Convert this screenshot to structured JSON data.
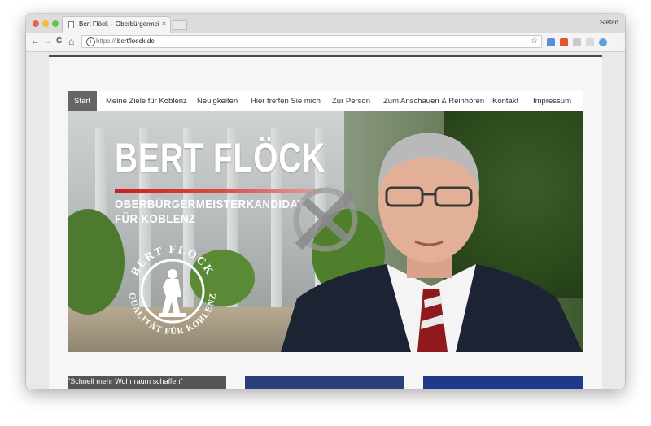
{
  "browser": {
    "tab_title": "Bert Flöck – Oberbürgermeiste",
    "tab_close": "×",
    "profile_name": "Stefan",
    "url_prefix": "https://",
    "url_host": "bertfloeck.de",
    "nav_icons": [
      "back-icon",
      "forward-icon",
      "reload-icon",
      "home-icon"
    ],
    "back_glyph": "←",
    "forward_glyph": "→",
    "reload_glyph": "C",
    "home_glyph": "⌂",
    "info_glyph": "i",
    "star_glyph": "☆",
    "menu_glyph": "⋮"
  },
  "site": {
    "nav": [
      {
        "label": "Start",
        "active": true
      },
      {
        "label": "Meine Ziele für Koblenz"
      },
      {
        "label": "Neuigkeiten"
      },
      {
        "label": "Hier treffen Sie mich"
      },
      {
        "label": "Zur Person"
      },
      {
        "label": "Zum Anschauen & Reinhören"
      },
      {
        "label": "Kontakt"
      },
      {
        "label": "Impressum"
      }
    ],
    "hero": {
      "title": "BERT FLÖCK",
      "subtitle_line1": "OBERBÜRGERMEISTERKANDIDAT",
      "subtitle_line2": "FÜR KOBLENZ",
      "seal_top": "BERT FLÖCK",
      "seal_bottom": "QUALITÄT FÜR KOBLENZ"
    },
    "cards": [
      {
        "text": "\"Schnell mehr Wohnraum schaffen\""
      },
      {
        "text": ""
      },
      {
        "text": ""
      }
    ]
  },
  "colors": {
    "accent_red": "#c8201f",
    "nav_active": "#666666",
    "card_blue": "#1f3a8a"
  }
}
